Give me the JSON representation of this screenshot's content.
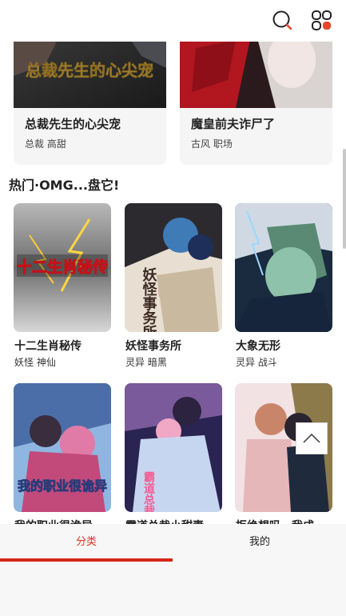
{
  "header": {
    "search_icon": "search-icon",
    "menu_icon": "grid-apps-icon"
  },
  "top_cards": [
    {
      "cover_text": "总裁先生的心尖宠",
      "title": "总裁先生的心尖宠",
      "tags": "总裁 高甜"
    },
    {
      "title": "魔皇前夫诈尸了",
      "tags": "古风 职场"
    }
  ],
  "section": {
    "title": "热门·OMG...盘它!"
  },
  "items": [
    {
      "cover_text": "十二生肖秘传",
      "title": "十二生肖秘传",
      "tags": "妖怪 神仙"
    },
    {
      "cover_text": "妖怪事务所",
      "title": "妖怪事务所",
      "tags": "灵异 暗黑"
    },
    {
      "title": "大象无形",
      "tags": "灵异 战斗"
    },
    {
      "cover_text": "我的职业很诡异",
      "title": "我的职业很诡异",
      "tags": ""
    },
    {
      "cover_text": "霸道总裁小甜妻",
      "title": "霸道总裁小甜妻",
      "tags": ""
    },
    {
      "title": "拒绝想吗，我成",
      "tags": ""
    }
  ],
  "tabs": {
    "classify": "分类",
    "mine": "我的"
  },
  "colors": {
    "accent": "#d8281b",
    "tab_active": "#e0341e"
  }
}
